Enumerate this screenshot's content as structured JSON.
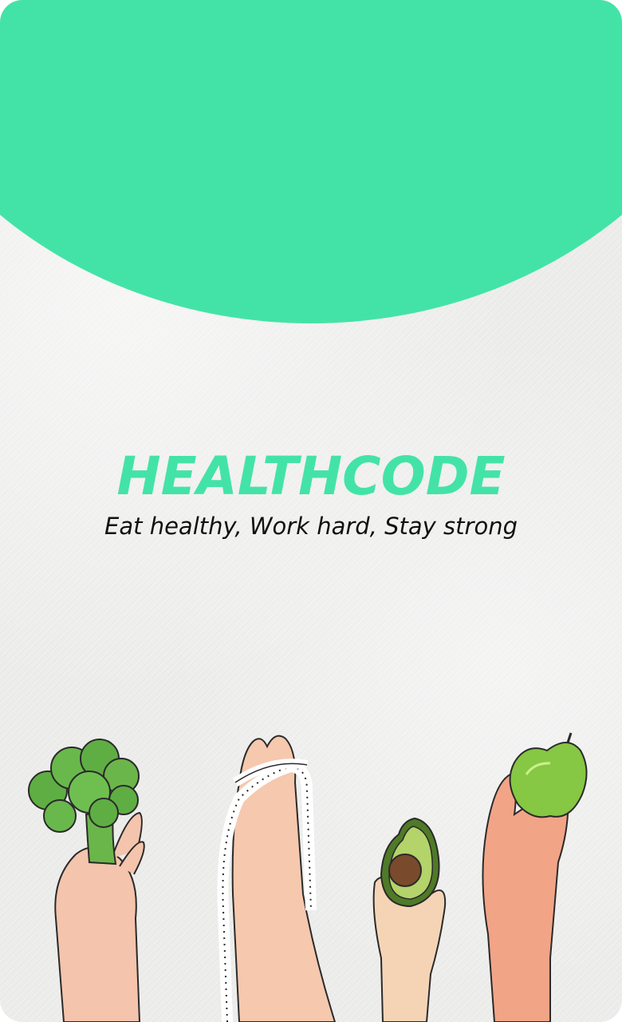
{
  "splash": {
    "app_name": "HEALTHCODE",
    "tagline": "Eat healthy, Work hard, Stay strong"
  },
  "theme": {
    "accent": "#43e3a7",
    "background": "#efefee",
    "text": "#111111"
  },
  "illustration": {
    "items": [
      "broccoli-icon",
      "tape-measure-icon",
      "avocado-icon",
      "apple-icon"
    ]
  }
}
